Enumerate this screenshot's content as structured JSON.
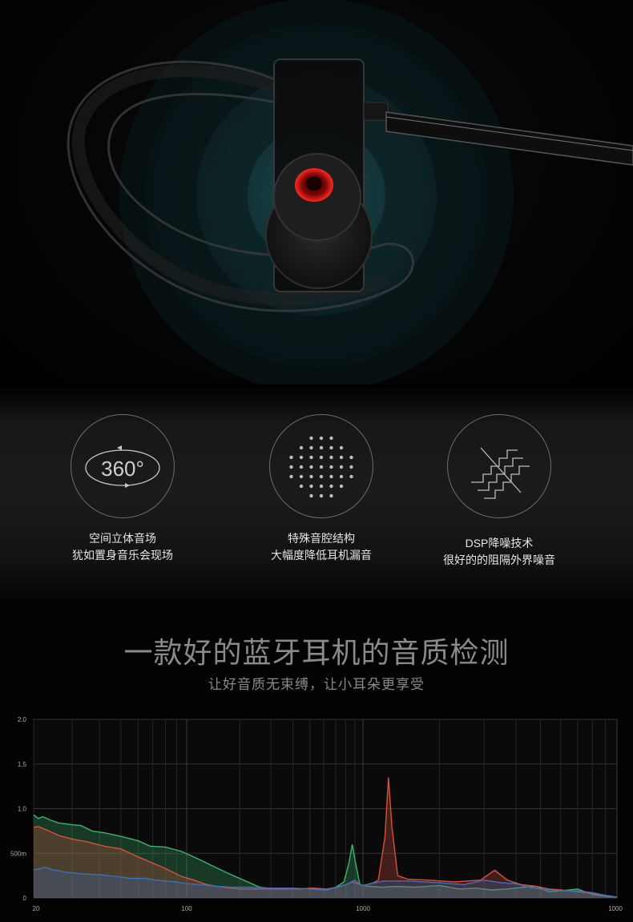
{
  "features": [
    {
      "icon": "360-icon",
      "line1": "空间立体音场",
      "line2": "犹如置身音乐会现场"
    },
    {
      "icon": "dot-grid-icon",
      "line1": "特殊音腔结构",
      "line2": "大幅度降低耳机漏音"
    },
    {
      "icon": "noise-reduction-icon",
      "line1": "DSP降噪技术",
      "line2": "很好的的阻隔外界噪音"
    }
  ],
  "icon_360_text": "360°",
  "headline": "一款好的蓝牙耳机的音质检测",
  "subheadline": "让好音质无束缚，让小耳朵更享受",
  "chart_data": {
    "type": "area",
    "x_scale": "log",
    "xlim": [
      20,
      1000
    ],
    "ylim": [
      0,
      2.0
    ],
    "x_ticks": [
      {
        "v": 20,
        "label": "20"
      },
      {
        "v": 100,
        "label": "100"
      },
      {
        "v": 1000,
        "label": "1000"
      },
      {
        "v": 1000,
        "label": "1000"
      }
    ],
    "y_ticks": [
      {
        "v": 0,
        "label": "0"
      },
      {
        "v": 0.5,
        "label": "500m"
      },
      {
        "v": 1.0,
        "label": "1.0"
      },
      {
        "v": 1.5,
        "label": "1.5"
      },
      {
        "v": 2.0,
        "label": "2.0"
      }
    ],
    "grid": true,
    "series": [
      {
        "color": "#3ab56a",
        "points": [
          [
            20,
            0.93
          ],
          [
            21,
            0.89
          ],
          [
            22,
            0.91
          ],
          [
            24,
            0.87
          ],
          [
            26,
            0.84
          ],
          [
            30,
            0.82
          ],
          [
            33,
            0.81
          ],
          [
            37,
            0.75
          ],
          [
            42,
            0.73
          ],
          [
            50,
            0.69
          ],
          [
            60,
            0.64
          ],
          [
            68,
            0.58
          ],
          [
            80,
            0.57
          ],
          [
            95,
            0.52
          ],
          [
            115,
            0.44
          ],
          [
            140,
            0.36
          ],
          [
            170,
            0.28
          ],
          [
            210,
            0.2
          ],
          [
            260,
            0.12
          ],
          [
            320,
            0.1
          ],
          [
            420,
            0.1
          ],
          [
            520,
            0.11
          ],
          [
            620,
            0.09
          ],
          [
            700,
            0.12
          ],
          [
            780,
            0.18
          ],
          [
            830,
            0.38
          ],
          [
            870,
            0.6
          ],
          [
            910,
            0.38
          ],
          [
            960,
            0.15
          ],
          [
            1050,
            0.13
          ],
          [
            1200,
            0.12
          ],
          [
            1350,
            0.13
          ],
          [
            1600,
            0.12
          ],
          [
            2000,
            0.14
          ],
          [
            2400,
            0.1
          ],
          [
            2800,
            0.11
          ],
          [
            3200,
            0.09
          ],
          [
            3700,
            0.1
          ],
          [
            4300,
            0.12
          ],
          [
            4800,
            0.13
          ],
          [
            5400,
            0.07
          ],
          [
            6000,
            0.08
          ],
          [
            7000,
            0.1
          ],
          [
            8000,
            0.04
          ],
          [
            9000,
            0.02
          ],
          [
            10000,
            0.01
          ]
        ]
      },
      {
        "color": "#d9503e",
        "points": [
          [
            20,
            0.79
          ],
          [
            21,
            0.8
          ],
          [
            23,
            0.76
          ],
          [
            26,
            0.7
          ],
          [
            30,
            0.66
          ],
          [
            35,
            0.63
          ],
          [
            42,
            0.58
          ],
          [
            50,
            0.55
          ],
          [
            60,
            0.46
          ],
          [
            70,
            0.39
          ],
          [
            80,
            0.33
          ],
          [
            95,
            0.24
          ],
          [
            110,
            0.2
          ],
          [
            130,
            0.15
          ],
          [
            160,
            0.12
          ],
          [
            200,
            0.1
          ],
          [
            260,
            0.1
          ],
          [
            330,
            0.1
          ],
          [
            430,
            0.1
          ],
          [
            520,
            0.11
          ],
          [
            620,
            0.1
          ],
          [
            720,
            0.12
          ],
          [
            800,
            0.15
          ],
          [
            870,
            0.18
          ],
          [
            930,
            0.16
          ],
          [
            1000,
            0.14
          ],
          [
            1100,
            0.17
          ],
          [
            1150,
            0.2
          ],
          [
            1220,
            0.68
          ],
          [
            1260,
            1.35
          ],
          [
            1300,
            0.8
          ],
          [
            1370,
            0.25
          ],
          [
            1500,
            0.21
          ],
          [
            1800,
            0.2
          ],
          [
            2300,
            0.18
          ],
          [
            2900,
            0.2
          ],
          [
            3300,
            0.31
          ],
          [
            3700,
            0.2
          ],
          [
            4200,
            0.15
          ],
          [
            4800,
            0.13
          ],
          [
            5400,
            0.1
          ],
          [
            6000,
            0.09
          ],
          [
            7000,
            0.07
          ],
          [
            8000,
            0.05
          ],
          [
            9000,
            0.03
          ],
          [
            10000,
            0.01
          ]
        ]
      },
      {
        "color": "#3d6fc0",
        "points": [
          [
            20,
            0.32
          ],
          [
            21,
            0.32
          ],
          [
            22,
            0.34
          ],
          [
            23,
            0.34
          ],
          [
            24,
            0.32
          ],
          [
            28,
            0.29
          ],
          [
            33,
            0.27
          ],
          [
            40,
            0.26
          ],
          [
            48,
            0.24
          ],
          [
            55,
            0.22
          ],
          [
            65,
            0.22
          ],
          [
            72,
            0.2
          ],
          [
            80,
            0.19
          ],
          [
            90,
            0.18
          ],
          [
            100,
            0.16
          ],
          [
            120,
            0.15
          ],
          [
            150,
            0.13
          ],
          [
            180,
            0.12
          ],
          [
            230,
            0.12
          ],
          [
            300,
            0.11
          ],
          [
            400,
            0.11
          ],
          [
            500,
            0.1
          ],
          [
            600,
            0.09
          ],
          [
            700,
            0.12
          ],
          [
            800,
            0.15
          ],
          [
            900,
            0.2
          ],
          [
            950,
            0.16
          ],
          [
            1000,
            0.14
          ],
          [
            1200,
            0.19
          ],
          [
            1500,
            0.19
          ],
          [
            2000,
            0.17
          ],
          [
            2500,
            0.15
          ],
          [
            3000,
            0.2
          ],
          [
            3500,
            0.17
          ],
          [
            4000,
            0.16
          ],
          [
            4500,
            0.12
          ],
          [
            5000,
            0.1
          ],
          [
            6000,
            0.08
          ],
          [
            7000,
            0.08
          ],
          [
            8000,
            0.06
          ],
          [
            9000,
            0.03
          ],
          [
            10000,
            0.01
          ]
        ]
      }
    ]
  }
}
